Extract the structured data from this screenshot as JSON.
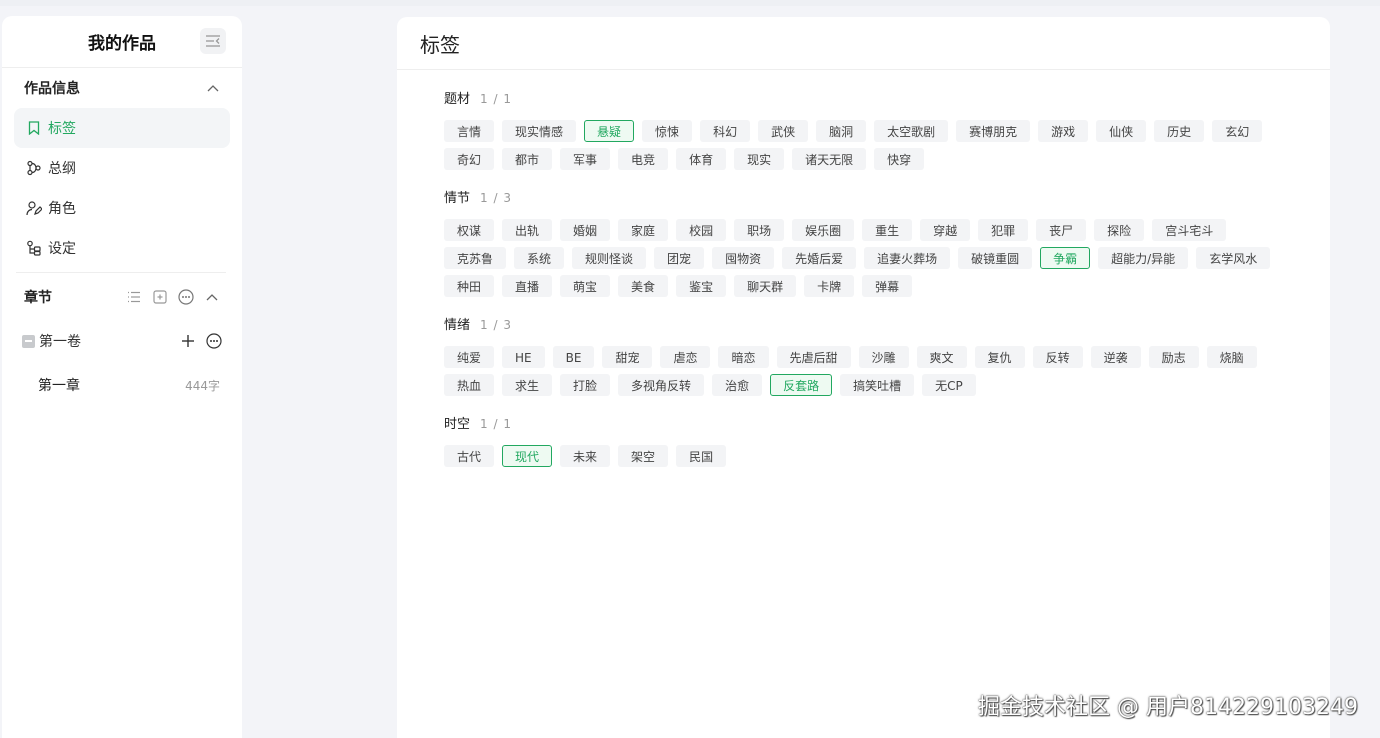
{
  "sidebar": {
    "title": "我的作品",
    "info_section": {
      "title": "作品信息",
      "items": [
        {
          "label": "标签",
          "icon": "bookmark-icon",
          "active": true
        },
        {
          "label": "总纲",
          "icon": "outline-icon"
        },
        {
          "label": "角色",
          "icon": "user-edit-icon"
        },
        {
          "label": "设定",
          "icon": "settings-tree-icon"
        }
      ]
    },
    "chapter_section": {
      "title": "章节",
      "volume": "第一卷",
      "chapters": [
        {
          "title": "第一章",
          "word_count": "444字"
        }
      ]
    }
  },
  "main": {
    "title": "标签",
    "categories": [
      {
        "name": "题材",
        "count": "1 / 1",
        "tags": [
          "言情",
          "现实情感",
          "悬疑",
          "惊悚",
          "科幻",
          "武侠",
          "脑洞",
          "太空歌剧",
          "赛博朋克",
          "游戏",
          "仙侠",
          "历史",
          "玄幻",
          "奇幻",
          "都市",
          "军事",
          "电竞",
          "体育",
          "现实",
          "诸天无限",
          "快穿"
        ],
        "selected": [
          "悬疑"
        ]
      },
      {
        "name": "情节",
        "count": "1 / 3",
        "tags": [
          "权谋",
          "出轨",
          "婚姻",
          "家庭",
          "校园",
          "职场",
          "娱乐圈",
          "重生",
          "穿越",
          "犯罪",
          "丧尸",
          "探险",
          "宫斗宅斗",
          "克苏鲁",
          "系统",
          "规则怪谈",
          "团宠",
          "囤物资",
          "先婚后爱",
          "追妻火葬场",
          "破镜重圆",
          "争霸",
          "超能力/异能",
          "玄学风水",
          "种田",
          "直播",
          "萌宝",
          "美食",
          "鉴宝",
          "聊天群",
          "卡牌",
          "弹幕"
        ],
        "selected": [
          "争霸"
        ]
      },
      {
        "name": "情绪",
        "count": "1 / 3",
        "tags": [
          "纯爱",
          "HE",
          "BE",
          "甜宠",
          "虐恋",
          "暗恋",
          "先虐后甜",
          "沙雕",
          "爽文",
          "复仇",
          "反转",
          "逆袭",
          "励志",
          "烧脑",
          "热血",
          "求生",
          "打脸",
          "多视角反转",
          "治愈",
          "反套路",
          "搞笑吐槽",
          "无CP"
        ],
        "selected": [
          "反套路"
        ]
      },
      {
        "name": "时空",
        "count": "1 / 1",
        "tags": [
          "古代",
          "现代",
          "未来",
          "架空",
          "民国"
        ],
        "selected": [
          "现代"
        ]
      }
    ]
  },
  "watermark": "掘金技术社区 @ 用户814229103249",
  "colors": {
    "accent": "#22a860",
    "tag_bg": "#f3f4f6",
    "page_bg": "#f3f4f8"
  }
}
